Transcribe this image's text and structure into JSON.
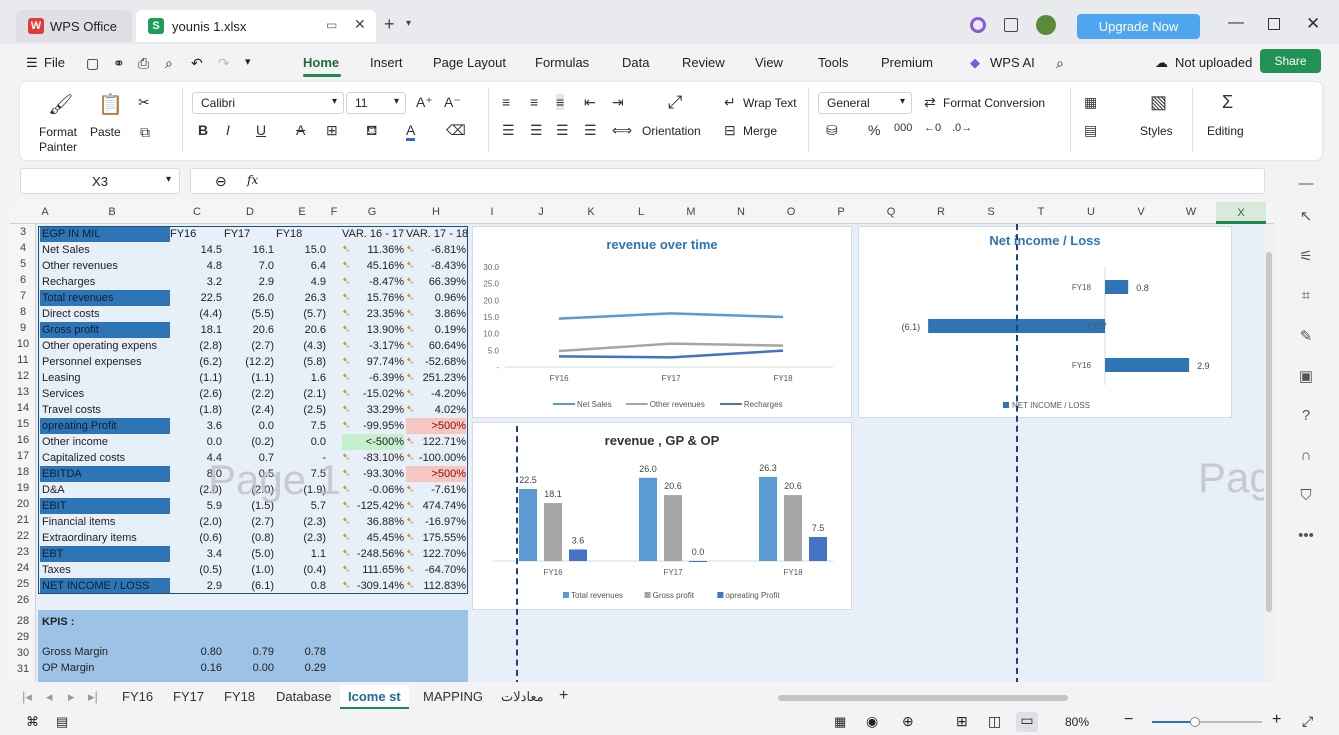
{
  "titlebar": {
    "wps_tab": "WPS Office",
    "file_tab": "younis 1.xlsx",
    "upgrade": "Upgrade Now"
  },
  "menu": {
    "file": "File",
    "items": [
      "Home",
      "Insert",
      "Page Layout",
      "Formulas",
      "Data",
      "Review",
      "View",
      "Tools",
      "Premium"
    ],
    "wps_ai": "WPS AI",
    "not_uploaded": "Not uploaded",
    "share": "Share"
  },
  "ribbon": {
    "format_painter": "Format Painter",
    "paste": "Paste",
    "font": "Calibri",
    "size": "11",
    "wrap_text": "Wrap Text",
    "orientation": "Orientation",
    "merge": "Merge",
    "number_format": "General",
    "format_conversion": "Format Conversion",
    "styles": "Styles",
    "editing": "Editing"
  },
  "formula": {
    "cell": "X3",
    "fx": "fx"
  },
  "columns": [
    "A",
    "B",
    "C",
    "D",
    "E",
    "F",
    "G",
    "H",
    "I",
    "J",
    "K",
    "L",
    "M",
    "N",
    "O",
    "P",
    "Q",
    "R",
    "S",
    "T",
    "U",
    "V",
    "W",
    "X"
  ],
  "rows": [
    {
      "n": "3",
      "label": "EGP IN MIL",
      "c": "FY16",
      "d": "FY17",
      "e": "FY18",
      "g": "VAR. 16 - 17",
      "h": "VAR. 17 - 18",
      "style": "hdr"
    },
    {
      "n": "4",
      "label": "Net Sales",
      "c": "14.5",
      "d": "16.1",
      "e": "15.0",
      "g": "11.36%",
      "h": "-6.81%"
    },
    {
      "n": "5",
      "label": "Other revenues",
      "c": "4.8",
      "d": "7.0",
      "e": "6.4",
      "g": "45.16%",
      "h": "-8.43%"
    },
    {
      "n": "6",
      "label": "Recharges",
      "c": "3.2",
      "d": "2.9",
      "e": "4.9",
      "g": "-8.47%",
      "h": "66.39%"
    },
    {
      "n": "7",
      "label": "Total revenues",
      "c": "22.5",
      "d": "26.0",
      "e": "26.3",
      "g": "15.76%",
      "h": "0.96%",
      "style": "band"
    },
    {
      "n": "8",
      "label": "Direct costs",
      "c": "(4.4)",
      "d": "(5.5)",
      "e": "(5.7)",
      "g": "23.35%",
      "h": "3.86%"
    },
    {
      "n": "9",
      "label": "Gross profit",
      "c": "18.1",
      "d": "20.6",
      "e": "20.6",
      "g": "13.90%",
      "h": "0.19%",
      "style": "band"
    },
    {
      "n": "10",
      "label": "Other operating expens",
      "c": "(2.8)",
      "d": "(2.7)",
      "e": "(4.3)",
      "g": "-3.17%",
      "h": "60.64%"
    },
    {
      "n": "11",
      "label": "Personnel expenses",
      "c": "(6.2)",
      "d": "(12.2)",
      "e": "(5.8)",
      "g": "97.74%",
      "h": "-52.68%"
    },
    {
      "n": "12",
      "label": "Leasing",
      "c": "(1.1)",
      "d": "(1.1)",
      "e": "1.6",
      "g": "-6.39%",
      "h": "251.23%"
    },
    {
      "n": "13",
      "label": "Services",
      "c": "(2.6)",
      "d": "(2.2)",
      "e": "(2.1)",
      "g": "-15.02%",
      "h": "-4.20%"
    },
    {
      "n": "14",
      "label": "Travel costs",
      "c": "(1.8)",
      "d": "(2.4)",
      "e": "(2.5)",
      "g": "33.29%",
      "h": "4.02%"
    },
    {
      "n": "15",
      "label": "opreating Profit",
      "c": "3.6",
      "d": "0.0",
      "e": "7.5",
      "g": "-99.95%",
      "h": ">500%",
      "style": "band",
      "hred": true
    },
    {
      "n": "16",
      "label": "Other income",
      "c": "0.0",
      "d": "(0.2)",
      "e": "0.0",
      "g": "<-500%",
      "h": "122.71%",
      "ggreen": true
    },
    {
      "n": "17",
      "label": "Capitalized costs",
      "c": "4.4",
      "d": "0.7",
      "e": "-",
      "g": "-83.10%",
      "h": "-100.00%"
    },
    {
      "n": "18",
      "label": "EBITDA",
      "c": "8.0",
      "d": "0.5",
      "e": "7.5",
      "g": "-93.30%",
      "h": ">500%",
      "style": "band",
      "hred": true
    },
    {
      "n": "19",
      "label": "D&A",
      "c": "(2.0)",
      "d": "(2.0)",
      "e": "(1.9)",
      "g": "-0.06%",
      "h": "-7.61%"
    },
    {
      "n": "20",
      "label": "EBIT",
      "c": "5.9",
      "d": "(1.5)",
      "e": "5.7",
      "g": "-125.42%",
      "h": "474.74%",
      "style": "band"
    },
    {
      "n": "21",
      "label": "Financial items",
      "c": "(2.0)",
      "d": "(2.7)",
      "e": "(2.3)",
      "g": "36.88%",
      "h": "-16.97%"
    },
    {
      "n": "22",
      "label": "Extraordinary items",
      "c": "(0.6)",
      "d": "(0.8)",
      "e": "(2.3)",
      "g": "45.45%",
      "h": "175.55%"
    },
    {
      "n": "23",
      "label": "EBT",
      "c": "3.4",
      "d": "(5.0)",
      "e": "1.1",
      "g": "-248.56%",
      "h": "122.70%",
      "style": "band"
    },
    {
      "n": "24",
      "label": "Taxes",
      "c": "(0.5)",
      "d": "(1.0)",
      "e": "(0.4)",
      "g": "111.65%",
      "h": "-64.70%"
    },
    {
      "n": "25",
      "label": "NET INCOME / LOSS",
      "c": "2.9",
      "d": "(6.1)",
      "e": "0.8",
      "g": "-309.14%",
      "h": "112.83%",
      "style": "band"
    }
  ],
  "kpis": {
    "title": "KPIS :",
    "rows": [
      {
        "label": "Gross Margin",
        "c": "0.80",
        "d": "0.79",
        "e": "0.78"
      },
      {
        "label": "OP Margin",
        "c": "0.16",
        "d": "0.00",
        "e": "0.29"
      }
    ]
  },
  "watermark": {
    "page1": "Page 1",
    "page_right": "Pag"
  },
  "chart_data": [
    {
      "type": "line",
      "title": "revenue over time",
      "x": [
        "FY16",
        "FY17",
        "FY18"
      ],
      "ylim": [
        0,
        30
      ],
      "yticks": [
        "30.0",
        "25.0",
        "20.0",
        "15.0",
        "10.0",
        "5.0",
        "-"
      ],
      "series": [
        {
          "name": "Net Sales",
          "values": [
            14.5,
            16.1,
            15.0
          ],
          "color": "#5b9bd5"
        },
        {
          "name": "Other revenues",
          "values": [
            4.8,
            7.0,
            6.4
          ],
          "color": "#a5a5a5"
        },
        {
          "name": "Recharges",
          "values": [
            3.2,
            2.9,
            4.9
          ],
          "color": "#4472c4"
        }
      ]
    },
    {
      "type": "bar",
      "title": "Net income / Loss",
      "orientation": "horizontal",
      "categories": [
        "FY18",
        "FY17",
        "FY16"
      ],
      "values": [
        0.8,
        -6.1,
        2.9
      ],
      "labels": [
        "0.8",
        "(6.1)",
        "2.9"
      ],
      "series_name": "NET INCOME / LOSS",
      "color": "#2e75b6"
    },
    {
      "type": "bar",
      "title": "revenue , GP & OP",
      "categories": [
        "FY16",
        "FY17",
        "FY18"
      ],
      "series": [
        {
          "name": "Total revenues",
          "values": [
            22.5,
            26.0,
            26.3
          ],
          "color": "#5b9bd5"
        },
        {
          "name": "Gross profit",
          "values": [
            18.1,
            20.6,
            20.6
          ],
          "color": "#a5a5a5"
        },
        {
          "name": "opreating Profit",
          "values": [
            3.6,
            0.0,
            7.5
          ],
          "color": "#4472c4"
        }
      ]
    }
  ],
  "sheet_tabs": [
    "FY16",
    "FY17",
    "FY18",
    "Database",
    "Icome st",
    "MAPPING",
    "معادلات"
  ],
  "active_tab": "Icome st",
  "status": {
    "zoom": "80%"
  },
  "colors": {
    "accent": "#1f9254",
    "band": "#2e75b6",
    "kpi": "#9cc3e6"
  }
}
